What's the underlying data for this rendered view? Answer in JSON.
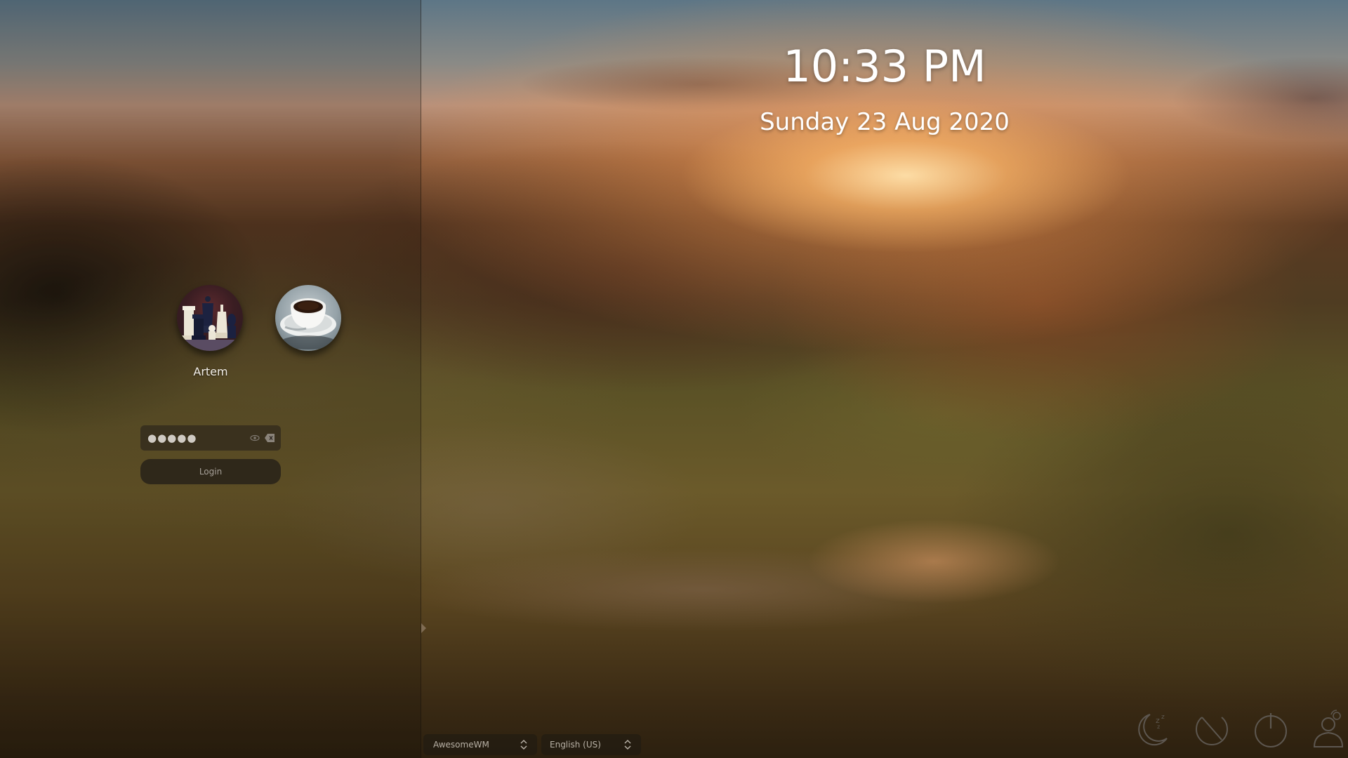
{
  "clock": {
    "time": "10:33 PM",
    "date": "Sunday 23 Aug 2020"
  },
  "users": [
    {
      "name": "Artem",
      "avatar": "chess-pieces"
    },
    {
      "name": "",
      "avatar": "coffee-cup"
    }
  ],
  "login": {
    "password_value": "●●●●●",
    "button_label": "Login"
  },
  "footer": {
    "session": "AwesomeWM",
    "language": "English (US)"
  },
  "actions": {
    "suspend": "moon-zzz-icon",
    "restart": "restart-icon",
    "shutdown": "power-icon",
    "switch_user": "switch-user-icon"
  }
}
